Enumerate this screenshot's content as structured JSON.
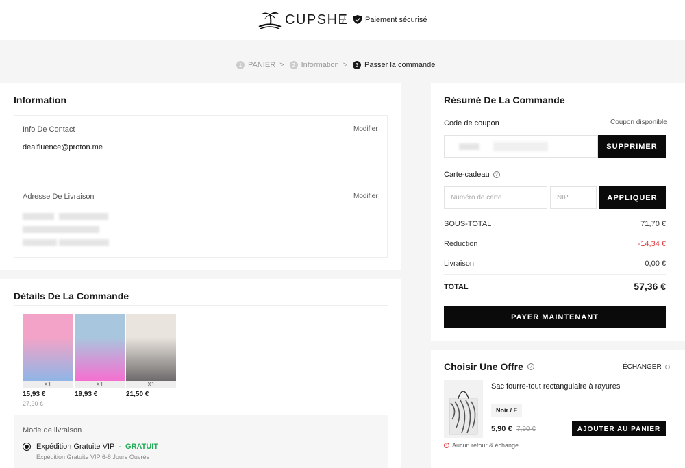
{
  "brand": "CUPSHE",
  "secure_label": "Paiement sécurisé",
  "steps": [
    {
      "num": "1",
      "label": "PANIER"
    },
    {
      "num": "2",
      "label": "Information"
    },
    {
      "num": "3",
      "label": "Passer la commande"
    }
  ],
  "information": {
    "title": "Information",
    "contact_label": "Info De Contact",
    "contact_edit": "Modifier",
    "email": "dealfluence@proton.me",
    "address_label": "Adresse De Livraison",
    "address_edit": "Modifier"
  },
  "order_details": {
    "title": "Détails De La Commande",
    "products": [
      {
        "qty": "X1",
        "price": "15,93 €",
        "old_price": "27,90 €",
        "colors": [
          "#f3a3c7",
          "#8fb5e6"
        ]
      },
      {
        "qty": "X1",
        "price": "19,93 €",
        "old_price": "",
        "colors": [
          "#a8c6de",
          "#f56fd0"
        ]
      },
      {
        "qty": "X1",
        "price": "21,50 €",
        "old_price": "",
        "colors": [
          "#e9e4dd",
          "#6d6a6b"
        ]
      }
    ],
    "shipping_label": "Mode de livraison",
    "shipping_option": "Expédition Gratuite VIP",
    "shipping_dash": "-",
    "shipping_free": "GRATUIT",
    "shipping_sub": "Expédition Gratuite VIP 6-8 Jours Ouvrés"
  },
  "summary": {
    "title": "Résumé De La Commande",
    "coupon_label": "Code de coupon",
    "coupon_available": "Coupon disponible",
    "remove_button": "SUPPRIMER",
    "gift_label": "Carte-cadeau",
    "card_placeholder": "Numéro de carte",
    "pin_placeholder": "NIP",
    "apply_button": "APPLIQUER",
    "subtotal_label": "SOUS-TOTAL",
    "subtotal_value": "71,70 €",
    "discount_label": "Réduction",
    "discount_value": "-14,34 €",
    "shipping_label": "Livraison",
    "shipping_value": "0,00 €",
    "total_label": "TOTAL",
    "total_value": "57,36 €",
    "pay_button": "PAYER MAINTENANT"
  },
  "offer": {
    "title": "Choisir Une Offre",
    "exchange_label": "ÉCHANGER",
    "product_name": "Sac fourre-tout rectangulaire à rayures",
    "variant": "Noir / F",
    "price": "5,90 €",
    "old_price": "7,90 €",
    "add_button": "AJOUTER AU PANIER",
    "no_return": "Aucun retour & échange"
  },
  "colors": {
    "accent_green": "#1fae56",
    "discount_red": "#e0393e",
    "dark": "#0a0a0a"
  }
}
